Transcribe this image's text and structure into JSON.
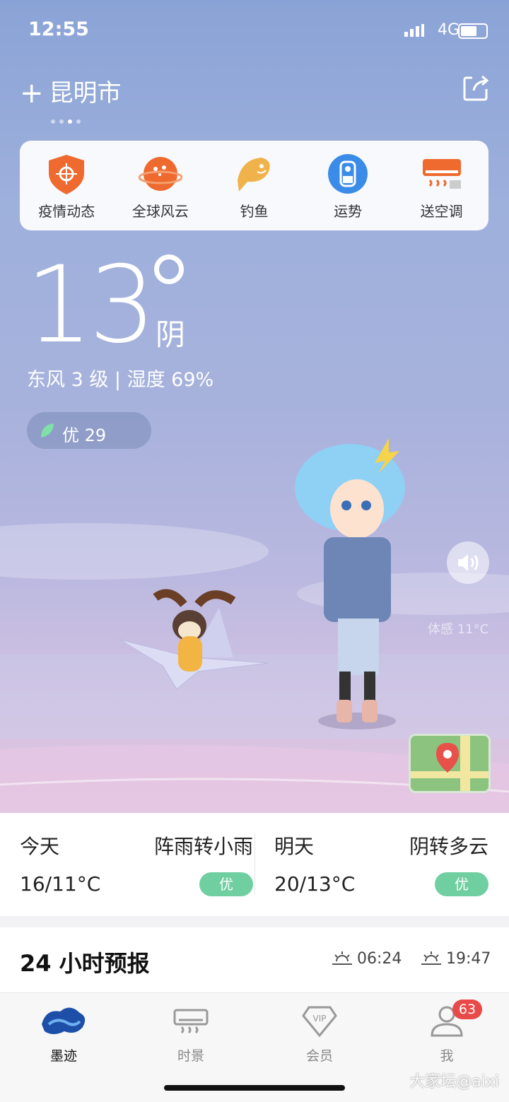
{
  "status_bar": {
    "time": "12:55",
    "network": "4G"
  },
  "header": {
    "city": "昆明市",
    "page_count": 4,
    "active_page": 2
  },
  "quick_actions": [
    {
      "label": "疫情动态",
      "icon": "epidemic-shield-icon",
      "color": "#ee6a2e"
    },
    {
      "label": "全球风云",
      "icon": "planet-icon",
      "color": "#ee6a2e"
    },
    {
      "label": "钓鱼",
      "icon": "fish-icon",
      "color": "#f0b24a"
    },
    {
      "label": "运势",
      "icon": "fortune-icon",
      "color": "#3b8be8"
    },
    {
      "label": "送空调",
      "icon": "air-conditioner-icon",
      "color": "#ee6a2e"
    }
  ],
  "current": {
    "temperature": "13",
    "condition": "阴",
    "wind_humidity": "东风 3 级 | 湿度 69%",
    "aqi_text": "优 29",
    "feels_like": "体感 11°C"
  },
  "forecast": {
    "today": {
      "day": "今天",
      "weather": "阵雨转小雨",
      "range": "16/11°C",
      "aqi": "优"
    },
    "tomorrow": {
      "day": "明天",
      "weather": "阴转多云",
      "range": "20/13°C",
      "aqi": "优"
    }
  },
  "hourly": {
    "title": "24 小时预报",
    "sunrise": "06:24",
    "sunset": "19:47"
  },
  "tabs": [
    {
      "label": "墨迹",
      "icon": "moji-logo-icon",
      "active": true
    },
    {
      "label": "时景",
      "icon": "scene-icon",
      "active": false
    },
    {
      "label": "会员",
      "icon": "vip-icon",
      "active": false
    },
    {
      "label": "我",
      "icon": "profile-icon",
      "active": false,
      "badge": "63"
    }
  ],
  "watermark": "大家坛@aixi",
  "colors": {
    "aqi_good": "#6fcfa0",
    "badge_red": "#e84a4a",
    "accent_orange": "#ee6a2e"
  }
}
